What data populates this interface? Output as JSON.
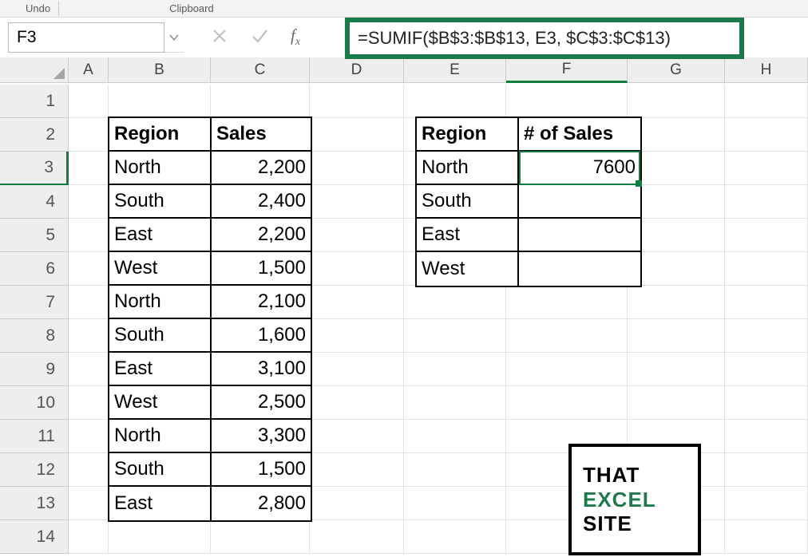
{
  "ribbon": {
    "undo": "Undo",
    "clipboard": "Clipboard"
  },
  "namebox": "F3",
  "formula": "=SUMIF($B$3:$B$13, E3, $C$3:$C$13)",
  "fx_label": "fx",
  "columns": [
    "A",
    "B",
    "C",
    "D",
    "E",
    "F",
    "G",
    "H"
  ],
  "rows": [
    "1",
    "2",
    "3",
    "4",
    "5",
    "6",
    "7",
    "8",
    "9",
    "10",
    "11",
    "12",
    "13",
    "14"
  ],
  "table1": {
    "headers": {
      "region": "Region",
      "sales": "Sales"
    },
    "rows": [
      {
        "region": "North",
        "sales": "2,200"
      },
      {
        "region": "South",
        "sales": "2,400"
      },
      {
        "region": "East",
        "sales": "2,200"
      },
      {
        "region": "West",
        "sales": "1,500"
      },
      {
        "region": "North",
        "sales": "2,100"
      },
      {
        "region": "South",
        "sales": "1,600"
      },
      {
        "region": "East",
        "sales": "3,100"
      },
      {
        "region": "West",
        "sales": "2,500"
      },
      {
        "region": "North",
        "sales": "3,300"
      },
      {
        "region": "South",
        "sales": "1,500"
      },
      {
        "region": "East",
        "sales": "2,800"
      }
    ]
  },
  "table2": {
    "headers": {
      "region": "Region",
      "nsales": "# of Sales"
    },
    "rows": [
      {
        "region": "North",
        "nsales": "7600"
      },
      {
        "region": "South",
        "nsales": ""
      },
      {
        "region": "East",
        "nsales": ""
      },
      {
        "region": "West",
        "nsales": ""
      }
    ]
  },
  "logo": {
    "line1": "THAT",
    "line2": "EXCEL",
    "line3": "SITE"
  }
}
